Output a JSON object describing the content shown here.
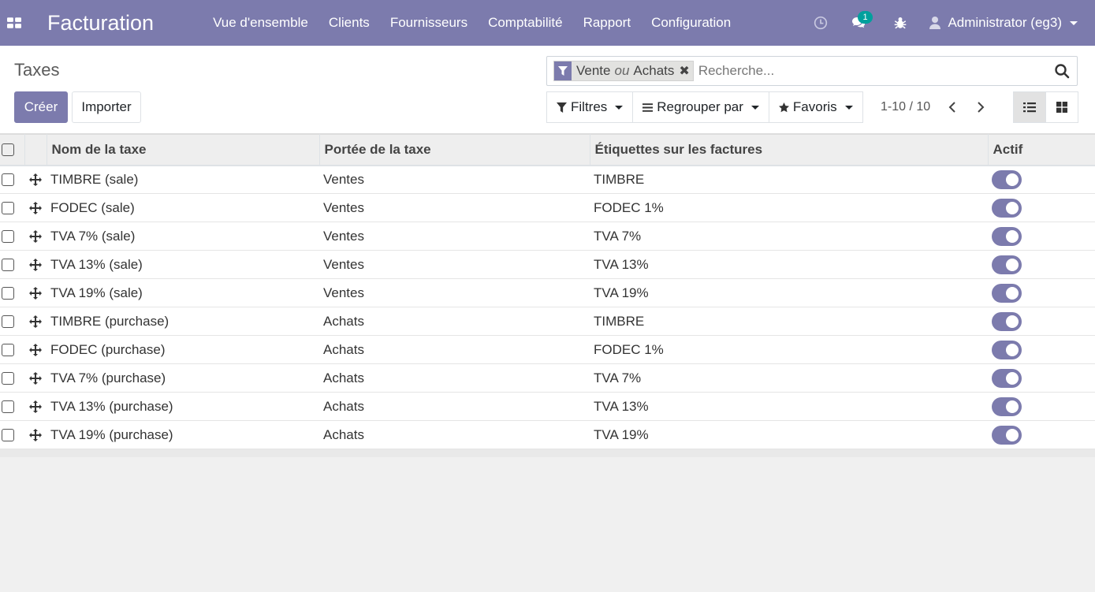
{
  "navbar": {
    "brand": "Facturation",
    "menu": [
      "Vue d'ensemble",
      "Clients",
      "Fournisseurs",
      "Comptabilité",
      "Rapport",
      "Configuration"
    ],
    "messages_badge": "1",
    "user": "Administrator (eg3)",
    "icons": [
      "apps-icon",
      "clock-icon",
      "chat-icon",
      "bug-icon",
      "user-icon"
    ]
  },
  "control_panel": {
    "breadcrumb": "Taxes",
    "create_label": "Créer",
    "import_label": "Importer",
    "search": {
      "facet_values": [
        "Vente",
        "Achats"
      ],
      "facet_separator": "ou",
      "placeholder": "Recherche..."
    },
    "filters_label": "Filtres",
    "groupby_label": "Regrouper par",
    "favorites_label": "Favoris",
    "pager": "1-10 / 10"
  },
  "table": {
    "headers": [
      "Nom de la taxe",
      "Portée de la taxe",
      "Étiquettes sur les factures",
      "Actif"
    ],
    "rows": [
      {
        "name": "TIMBRE (sale)",
        "scope": "Ventes",
        "label": "TIMBRE",
        "active": true
      },
      {
        "name": "FODEC (sale)",
        "scope": "Ventes",
        "label": "FODEC 1%",
        "active": true
      },
      {
        "name": "TVA 7% (sale)",
        "scope": "Ventes",
        "label": "TVA 7%",
        "active": true
      },
      {
        "name": "TVA 13% (sale)",
        "scope": "Ventes",
        "label": "TVA 13%",
        "active": true
      },
      {
        "name": "TVA 19% (sale)",
        "scope": "Ventes",
        "label": "TVA 19%",
        "active": true
      },
      {
        "name": "TIMBRE (purchase)",
        "scope": "Achats",
        "label": "TIMBRE",
        "active": true
      },
      {
        "name": "FODEC (purchase)",
        "scope": "Achats",
        "label": "FODEC 1%",
        "active": true
      },
      {
        "name": "TVA 7% (purchase)",
        "scope": "Achats",
        "label": "TVA 7%",
        "active": true
      },
      {
        "name": "TVA 13% (purchase)",
        "scope": "Achats",
        "label": "TVA 13%",
        "active": true
      },
      {
        "name": "TVA 19% (purchase)",
        "scope": "Achats",
        "label": "TVA 19%",
        "active": true
      }
    ]
  },
  "colors": {
    "brand": "#7c7bad",
    "badge": "#00a09d"
  }
}
